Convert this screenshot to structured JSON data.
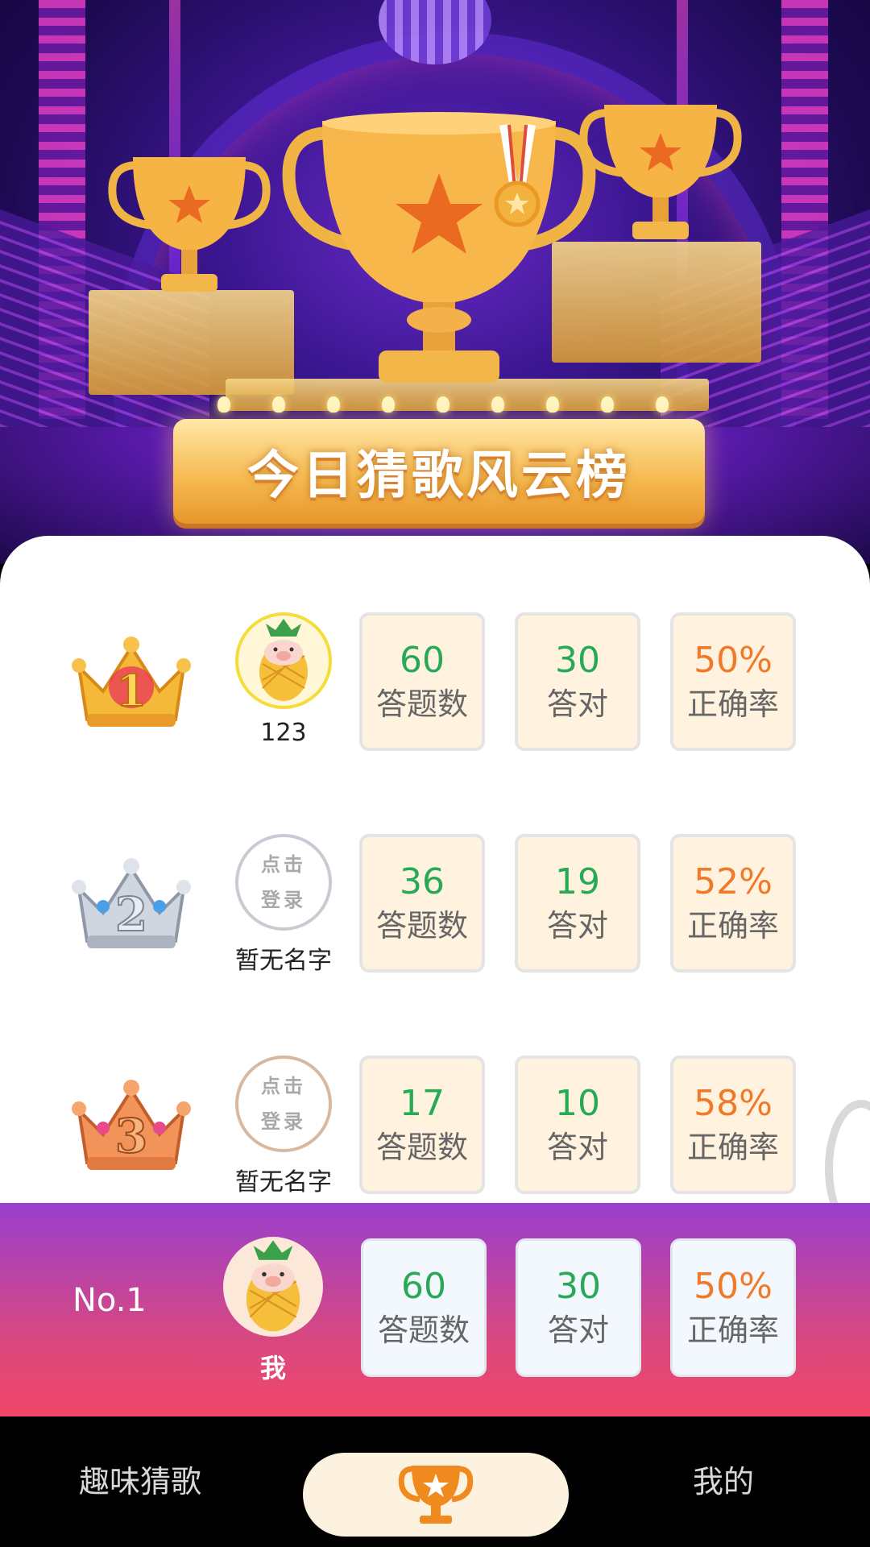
{
  "hero": {
    "banner_title": "今日猜歌风云榜"
  },
  "leaderboard": [
    {
      "rank": 1,
      "avatar": "pineapple-pig",
      "name": "123",
      "answered": "60",
      "answered_label": "答题数",
      "correct": "30",
      "correct_label": "答对",
      "accuracy": "50%",
      "accuracy_label": "正确率"
    },
    {
      "rank": 2,
      "avatar": "login",
      "avatar_text_1": "点击",
      "avatar_text_2": "登录",
      "name": "暂无名字",
      "answered": "36",
      "answered_label": "答题数",
      "correct": "19",
      "correct_label": "答对",
      "accuracy": "52%",
      "accuracy_label": "正确率"
    },
    {
      "rank": 3,
      "avatar": "login",
      "avatar_text_1": "点击",
      "avatar_text_2": "登录",
      "name": "暂无名字",
      "answered": "17",
      "answered_label": "答题数",
      "correct": "10",
      "correct_label": "答对",
      "accuracy": "58%",
      "accuracy_label": "正确率"
    }
  ],
  "my_rank": {
    "rank_label": "No.1",
    "name": "我",
    "answered": "60",
    "answered_label": "答题数",
    "correct": "30",
    "correct_label": "答对",
    "accuracy": "50%",
    "accuracy_label": "正确率"
  },
  "tabbar": {
    "left_label": "趣味猜歌",
    "center_icon": "trophy-icon",
    "right_label": "我的"
  },
  "colors": {
    "stat_value_green": "#27a955",
    "stat_value_orange": "#f07a2a",
    "stat_bg": "#fff3e0",
    "my_bar_top": "#9a3fcf",
    "my_bar_bottom": "#f3466a"
  }
}
